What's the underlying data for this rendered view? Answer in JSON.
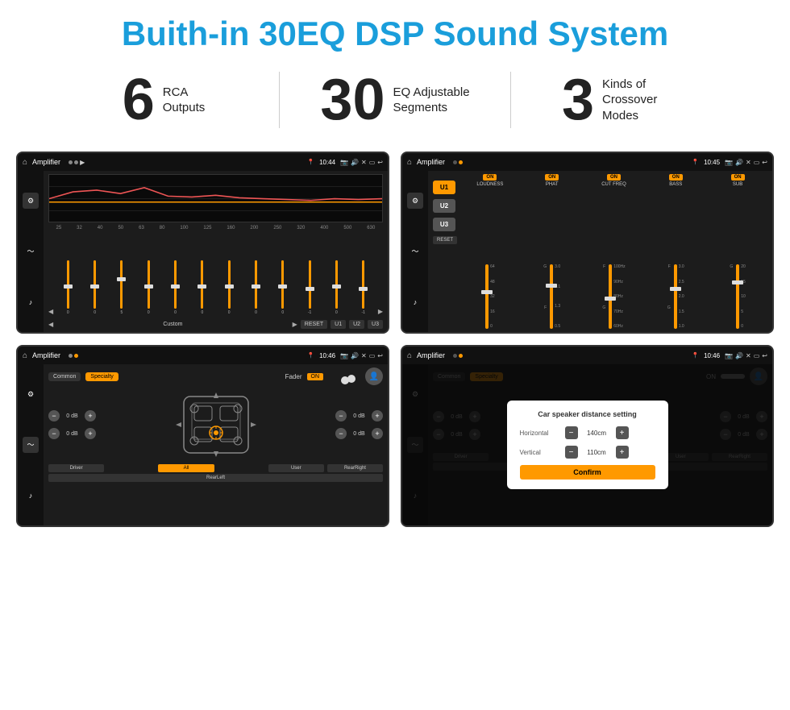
{
  "header": {
    "title": "Buith-in 30EQ DSP Sound System"
  },
  "stats": [
    {
      "number": "6",
      "label": "RCA\nOutputs"
    },
    {
      "number": "30",
      "label": "EQ Adjustable\nSegments"
    },
    {
      "number": "3",
      "label": "Kinds of\nCrossover Modes"
    }
  ],
  "screens": {
    "eq_screen": {
      "title": "Amplifier",
      "time": "10:44",
      "freqs": [
        "25",
        "32",
        "40",
        "50",
        "63",
        "80",
        "100",
        "125",
        "160",
        "200",
        "250",
        "320",
        "400",
        "500",
        "630"
      ],
      "values": [
        "0",
        "0",
        "0",
        "5",
        "0",
        "0",
        "0",
        "0",
        "0",
        "0",
        "0",
        "-1",
        "0",
        "-1"
      ],
      "bottom_buttons": [
        "Custom",
        "RESET",
        "U1",
        "U2",
        "U3"
      ]
    },
    "crossover_screen": {
      "title": "Amplifier",
      "time": "10:45",
      "u_buttons": [
        "U1",
        "U2",
        "U3"
      ],
      "channels": [
        {
          "label": "LOUDNESS",
          "on": true
        },
        {
          "label": "PHAT",
          "on": true
        },
        {
          "label": "CUT FREQ",
          "on": true
        },
        {
          "label": "BASS",
          "on": true
        },
        {
          "label": "SUB",
          "on": true
        }
      ],
      "reset": "RESET"
    },
    "fader_screen": {
      "title": "Amplifier",
      "time": "10:46",
      "tabs": [
        "Common",
        "Specialty"
      ],
      "fader_label": "Fader",
      "fader_on": "ON",
      "volumes": [
        {
          "label": "0 dB"
        },
        {
          "label": "0 dB"
        },
        {
          "label": "0 dB"
        },
        {
          "label": "0 dB"
        }
      ],
      "bottom_buttons": [
        "Driver",
        "",
        "All",
        "User",
        "RearRight"
      ],
      "left_buttons": [
        "Driver",
        "RearLeft"
      ]
    },
    "distance_screen": {
      "title": "Amplifier",
      "time": "10:46",
      "dialog": {
        "title": "Car speaker distance setting",
        "horizontal_label": "Horizontal",
        "horizontal_value": "140cm",
        "vertical_label": "Vertical",
        "vertical_value": "110cm",
        "confirm_label": "Confirm"
      }
    }
  }
}
